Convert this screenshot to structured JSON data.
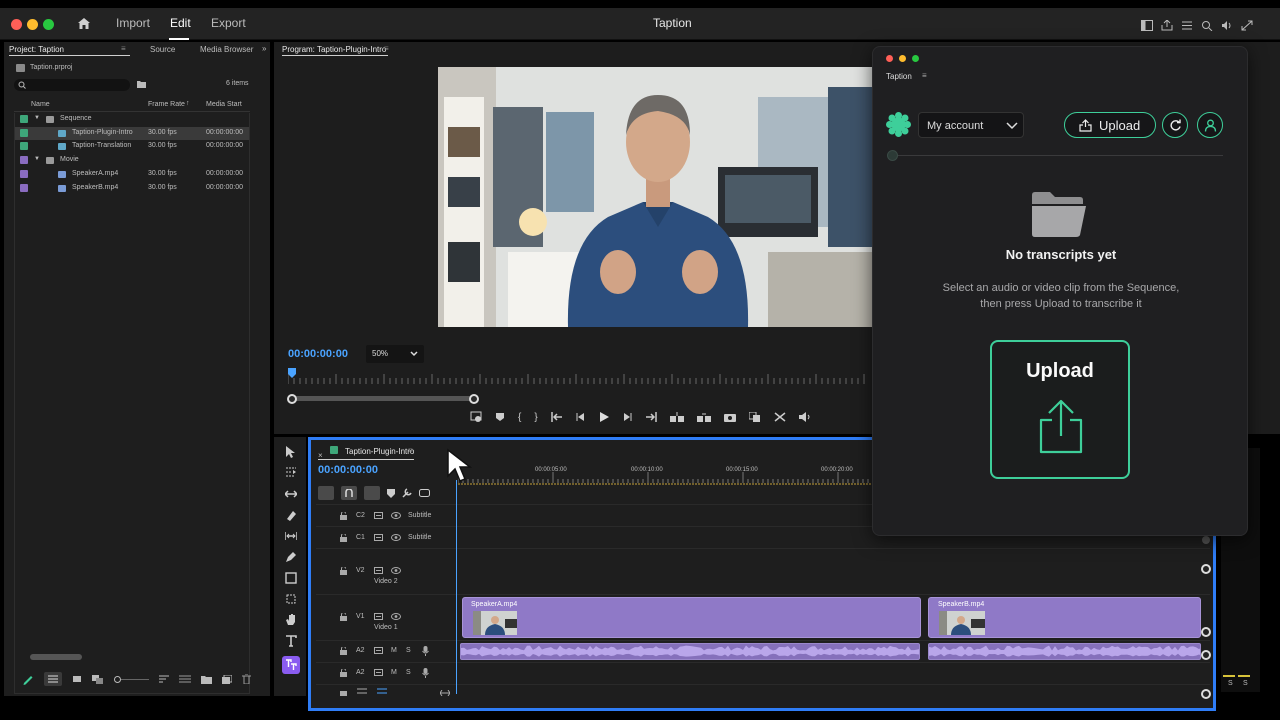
{
  "window": {
    "title": "Taption",
    "menu": [
      "Import",
      "Edit",
      "Export"
    ]
  },
  "project": {
    "tab_project": "Project: Taption",
    "tab_source": "Source",
    "tab_media_browser": "Media Browser",
    "file": "Taption.prproj",
    "items_count": "6 items",
    "col_name": "Name",
    "col_frame_rate": "Frame Rate",
    "col_media_start": "Media Start",
    "rows": [
      {
        "name": "Sequence",
        "rate": "",
        "start": "",
        "color": "#3ea77a",
        "type": "folder",
        "indent": 0
      },
      {
        "name": "Taption-Plugin-Intro",
        "rate": "30.00 fps",
        "start": "00:00:00:00",
        "color": "#3ea77a",
        "type": "sequence",
        "indent": 1
      },
      {
        "name": "Taption-Translation",
        "rate": "30.00 fps",
        "start": "00:00:00:00",
        "color": "#3ea77a",
        "type": "sequence",
        "indent": 1
      },
      {
        "name": "Movie",
        "rate": "",
        "start": "",
        "color": "#8a6cc0",
        "type": "folder",
        "indent": 0
      },
      {
        "name": "SpeakerA.mp4",
        "rate": "30.00 fps",
        "start": "00:00:00:00",
        "color": "#8a6cc0",
        "type": "clip",
        "indent": 1
      },
      {
        "name": "SpeakerB.mp4",
        "rate": "30.00 fps",
        "start": "00:00:00:00",
        "color": "#8a6cc0",
        "type": "clip",
        "indent": 1
      }
    ]
  },
  "program": {
    "title": "Program: Taption-Plugin-Intro",
    "timecode": "00:00:00:00",
    "zoom": "50%"
  },
  "timeline": {
    "sequence_tab": "Taption-Plugin-Intro",
    "timecode": "00:00:00:00",
    "ruler": [
      "00:00:05:00",
      "00:00:10:00",
      "00:00:15:00",
      "00:00:20:00"
    ],
    "tracks": {
      "c2": "C2",
      "c1": "C1",
      "v2": "V2",
      "v1": "V1",
      "a2a": "A2",
      "a2b": "A2",
      "subtitle": "Subtitle",
      "video2": "Video 2",
      "video1": "Video 1",
      "m": "M",
      "s": "S"
    },
    "clip_a": "SpeakerA.mp4",
    "clip_b": "SpeakerB.mp4"
  },
  "meter": {
    "s1": "S",
    "s2": "S"
  },
  "taption": {
    "title": "Taption",
    "account": "My account",
    "upload": "Upload",
    "empty_title": "No transcripts yet",
    "empty_line1": "Select an audio or video clip from the Sequence,",
    "empty_line2": "then press Upload to transcribe it",
    "big_upload": "Upload",
    "accent": "#3ecf9a"
  }
}
